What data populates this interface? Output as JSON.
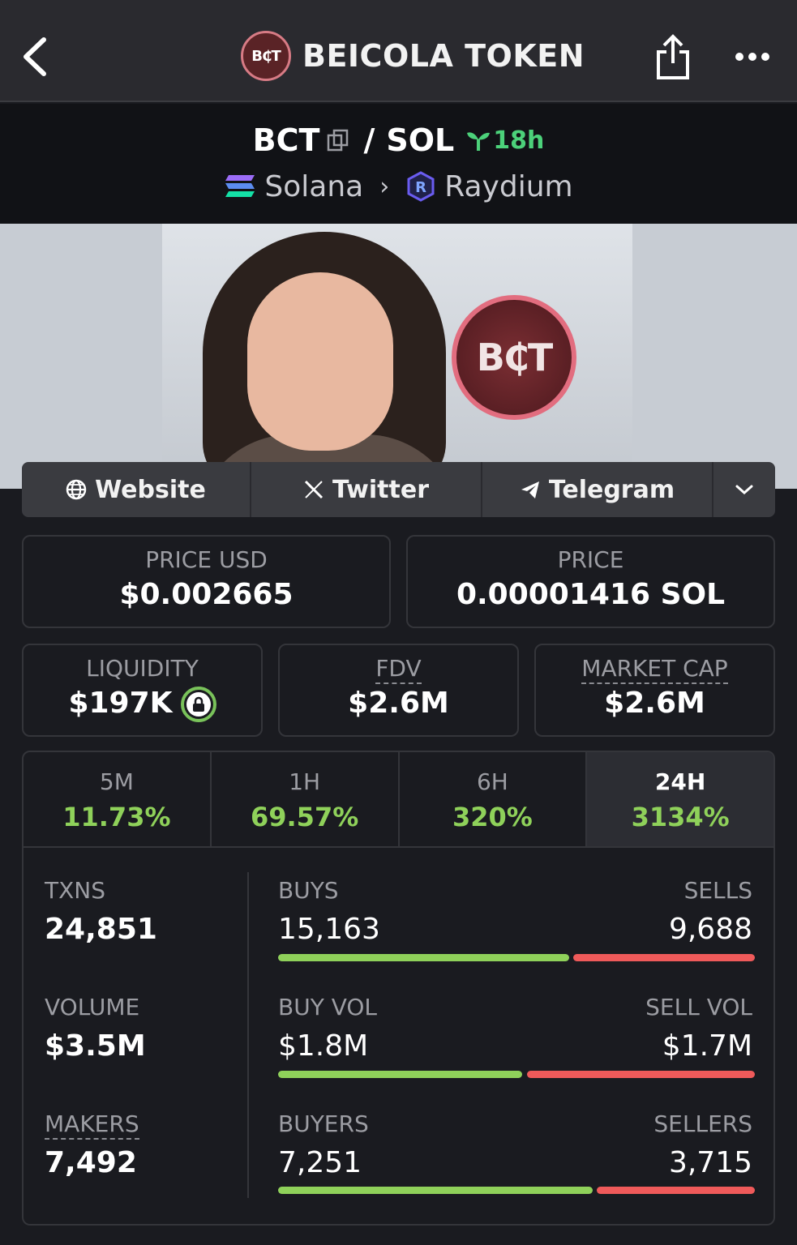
{
  "header": {
    "title": "BEICOLA TOKEN",
    "logo_text": "B₵T",
    "icons": {
      "back": "chevron-left-icon",
      "share": "share-icon",
      "more": "more-icon"
    }
  },
  "pair": {
    "base": "BCT",
    "separator": "/",
    "quote": "SOL",
    "age": "18h",
    "chain": "Solana",
    "dex": "Raydium"
  },
  "banner": {
    "coin_text": "B₵T"
  },
  "links": {
    "website": "Website",
    "twitter": "Twitter",
    "telegram": "Telegram"
  },
  "prices": {
    "usd_label": "PRICE USD",
    "usd_value": "$0.002665",
    "native_label": "PRICE",
    "native_value": "0.00001416 SOL"
  },
  "metrics": {
    "liquidity_label": "LIQUIDITY",
    "liquidity_value": "$197K",
    "fdv_label": "FDV",
    "fdv_value": "$2.6M",
    "mcap_label": "MARKET CAP",
    "mcap_value": "$2.6M"
  },
  "changes": [
    {
      "label": "5M",
      "value": "11.73%"
    },
    {
      "label": "1H",
      "value": "69.57%"
    },
    {
      "label": "6H",
      "value": "320%"
    },
    {
      "label": "24H",
      "value": "3134%"
    }
  ],
  "tx": {
    "txns_label": "TXNS",
    "txns_value": "24,851",
    "volume_label": "VOLUME",
    "volume_value": "$3.5M",
    "makers_label": "MAKERS",
    "makers_value": "7,492",
    "buys_label": "BUYS",
    "buys_value": "15,163",
    "sells_label": "SELLS",
    "sells_value": "9,688",
    "buyvol_label": "BUY VOL",
    "buyvol_value": "$1.8M",
    "sellvol_label": "SELL VOL",
    "sellvol_value": "$1.7M",
    "buyers_label": "BUYERS",
    "buyers_value": "7,251",
    "sellers_label": "SELLERS",
    "sellers_value": "3,715"
  },
  "colors": {
    "positive": "#8fd15a",
    "negative": "#ef5a5a",
    "age": "#4cd17a"
  }
}
